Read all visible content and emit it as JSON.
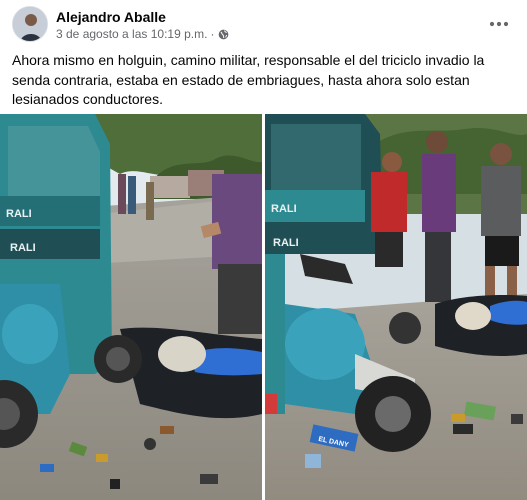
{
  "post": {
    "author": "Alejandro Aballe",
    "timestamp": "3 de agosto a las 10:19 p.m.",
    "separator": "·",
    "privacy_icon": "globe-icon",
    "more_icon": "more-options-icon",
    "text": "Ahora mismo en holguin, camino militar, responsable el del triciclo invadio la senda contraria, estaba en estado de embriagues, hasta ahora solo estan lesianados conductores."
  },
  "photos": {
    "left": {
      "brand_top": "RALI",
      "brand_bottom": "RALI"
    },
    "right": {
      "brand_top": "RALI",
      "brand_bottom": "RALI",
      "can_label": "EL DANY"
    }
  },
  "colors": {
    "text": "#050505",
    "secondary": "#65676b",
    "teal": "#2e8a91",
    "sky": "#d9e6ee"
  }
}
